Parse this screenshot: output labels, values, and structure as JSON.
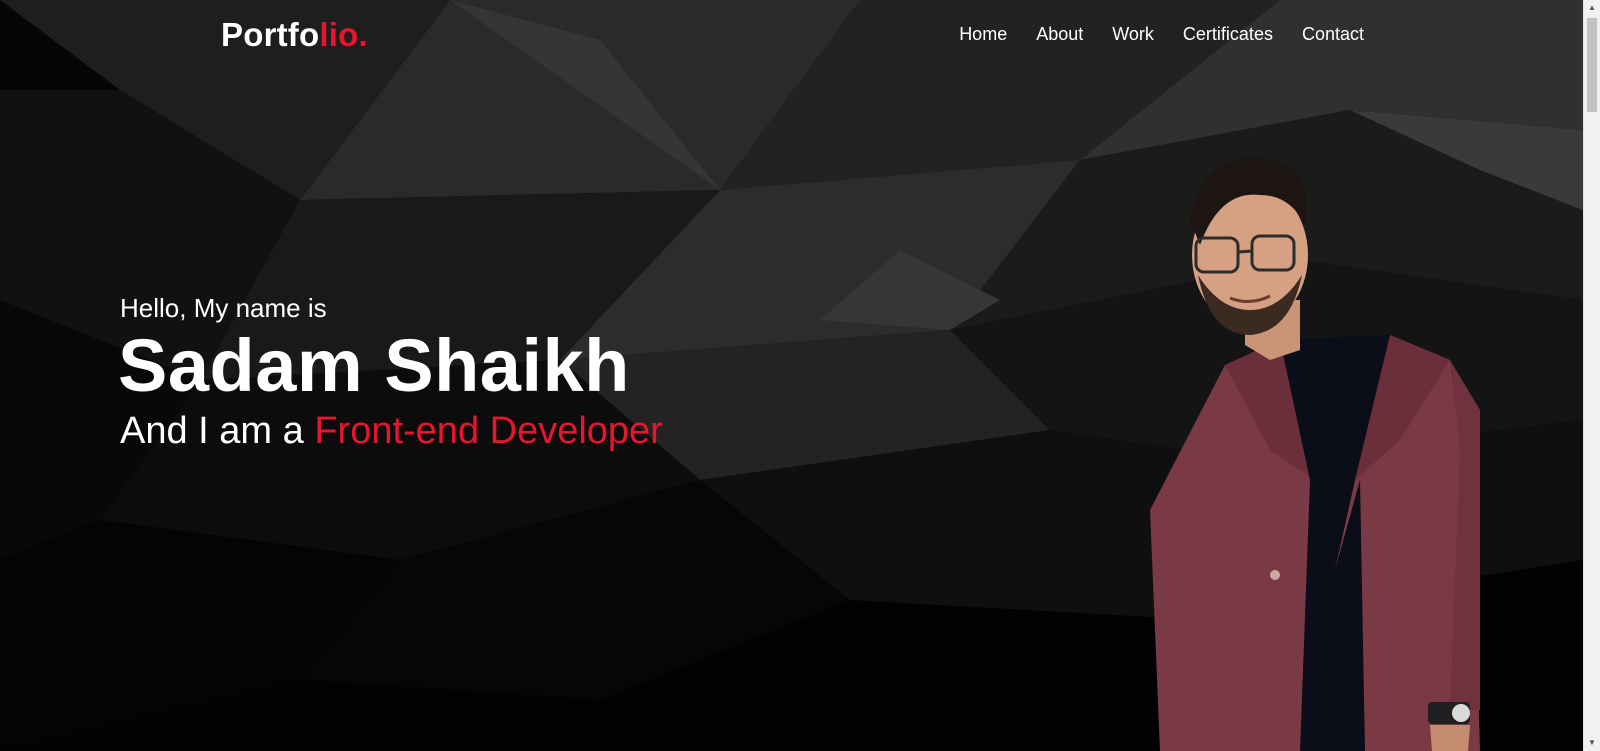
{
  "header": {
    "brand_main": "Portfo",
    "brand_accent": "lio.",
    "nav": [
      {
        "label": "Home"
      },
      {
        "label": "About"
      },
      {
        "label": "Work"
      },
      {
        "label": "Certificates"
      },
      {
        "label": "Contact"
      }
    ]
  },
  "hero": {
    "greeting": "Hello, My name is",
    "name": "Sadam Shaikh",
    "role_prefix": "And I am a ",
    "role_highlight": "Front-end Developer"
  },
  "colors": {
    "accent": "#e8152e",
    "background": "#000000",
    "text": "#ffffff",
    "blazer": "#7a3a45"
  },
  "icons": {
    "scroll_up": "triangle-up-icon",
    "scroll_down": "triangle-down-icon"
  }
}
